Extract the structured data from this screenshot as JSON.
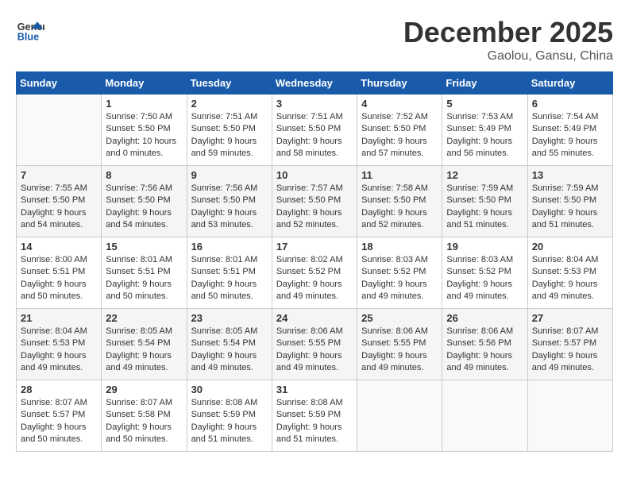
{
  "header": {
    "logo_line1": "General",
    "logo_line2": "Blue",
    "month": "December 2025",
    "location": "Gaolou, Gansu, China"
  },
  "days_of_week": [
    "Sunday",
    "Monday",
    "Tuesday",
    "Wednesday",
    "Thursday",
    "Friday",
    "Saturday"
  ],
  "weeks": [
    [
      {
        "day": "",
        "content": ""
      },
      {
        "day": "1",
        "content": "Sunrise: 7:50 AM\nSunset: 5:50 PM\nDaylight: 10 hours\nand 0 minutes."
      },
      {
        "day": "2",
        "content": "Sunrise: 7:51 AM\nSunset: 5:50 PM\nDaylight: 9 hours\nand 59 minutes."
      },
      {
        "day": "3",
        "content": "Sunrise: 7:51 AM\nSunset: 5:50 PM\nDaylight: 9 hours\nand 58 minutes."
      },
      {
        "day": "4",
        "content": "Sunrise: 7:52 AM\nSunset: 5:50 PM\nDaylight: 9 hours\nand 57 minutes."
      },
      {
        "day": "5",
        "content": "Sunrise: 7:53 AM\nSunset: 5:49 PM\nDaylight: 9 hours\nand 56 minutes."
      },
      {
        "day": "6",
        "content": "Sunrise: 7:54 AM\nSunset: 5:49 PM\nDaylight: 9 hours\nand 55 minutes."
      }
    ],
    [
      {
        "day": "7",
        "content": "Sunrise: 7:55 AM\nSunset: 5:50 PM\nDaylight: 9 hours\nand 54 minutes."
      },
      {
        "day": "8",
        "content": "Sunrise: 7:56 AM\nSunset: 5:50 PM\nDaylight: 9 hours\nand 54 minutes."
      },
      {
        "day": "9",
        "content": "Sunrise: 7:56 AM\nSunset: 5:50 PM\nDaylight: 9 hours\nand 53 minutes."
      },
      {
        "day": "10",
        "content": "Sunrise: 7:57 AM\nSunset: 5:50 PM\nDaylight: 9 hours\nand 52 minutes."
      },
      {
        "day": "11",
        "content": "Sunrise: 7:58 AM\nSunset: 5:50 PM\nDaylight: 9 hours\nand 52 minutes."
      },
      {
        "day": "12",
        "content": "Sunrise: 7:59 AM\nSunset: 5:50 PM\nDaylight: 9 hours\nand 51 minutes."
      },
      {
        "day": "13",
        "content": "Sunrise: 7:59 AM\nSunset: 5:50 PM\nDaylight: 9 hours\nand 51 minutes."
      }
    ],
    [
      {
        "day": "14",
        "content": "Sunrise: 8:00 AM\nSunset: 5:51 PM\nDaylight: 9 hours\nand 50 minutes."
      },
      {
        "day": "15",
        "content": "Sunrise: 8:01 AM\nSunset: 5:51 PM\nDaylight: 9 hours\nand 50 minutes."
      },
      {
        "day": "16",
        "content": "Sunrise: 8:01 AM\nSunset: 5:51 PM\nDaylight: 9 hours\nand 50 minutes."
      },
      {
        "day": "17",
        "content": "Sunrise: 8:02 AM\nSunset: 5:52 PM\nDaylight: 9 hours\nand 49 minutes."
      },
      {
        "day": "18",
        "content": "Sunrise: 8:03 AM\nSunset: 5:52 PM\nDaylight: 9 hours\nand 49 minutes."
      },
      {
        "day": "19",
        "content": "Sunrise: 8:03 AM\nSunset: 5:52 PM\nDaylight: 9 hours\nand 49 minutes."
      },
      {
        "day": "20",
        "content": "Sunrise: 8:04 AM\nSunset: 5:53 PM\nDaylight: 9 hours\nand 49 minutes."
      }
    ],
    [
      {
        "day": "21",
        "content": "Sunrise: 8:04 AM\nSunset: 5:53 PM\nDaylight: 9 hours\nand 49 minutes."
      },
      {
        "day": "22",
        "content": "Sunrise: 8:05 AM\nSunset: 5:54 PM\nDaylight: 9 hours\nand 49 minutes."
      },
      {
        "day": "23",
        "content": "Sunrise: 8:05 AM\nSunset: 5:54 PM\nDaylight: 9 hours\nand 49 minutes."
      },
      {
        "day": "24",
        "content": "Sunrise: 8:06 AM\nSunset: 5:55 PM\nDaylight: 9 hours\nand 49 minutes."
      },
      {
        "day": "25",
        "content": "Sunrise: 8:06 AM\nSunset: 5:55 PM\nDaylight: 9 hours\nand 49 minutes."
      },
      {
        "day": "26",
        "content": "Sunrise: 8:06 AM\nSunset: 5:56 PM\nDaylight: 9 hours\nand 49 minutes."
      },
      {
        "day": "27",
        "content": "Sunrise: 8:07 AM\nSunset: 5:57 PM\nDaylight: 9 hours\nand 49 minutes."
      }
    ],
    [
      {
        "day": "28",
        "content": "Sunrise: 8:07 AM\nSunset: 5:57 PM\nDaylight: 9 hours\nand 50 minutes."
      },
      {
        "day": "29",
        "content": "Sunrise: 8:07 AM\nSunset: 5:58 PM\nDaylight: 9 hours\nand 50 minutes."
      },
      {
        "day": "30",
        "content": "Sunrise: 8:08 AM\nSunset: 5:59 PM\nDaylight: 9 hours\nand 51 minutes."
      },
      {
        "day": "31",
        "content": "Sunrise: 8:08 AM\nSunset: 5:59 PM\nDaylight: 9 hours\nand 51 minutes."
      },
      {
        "day": "",
        "content": ""
      },
      {
        "day": "",
        "content": ""
      },
      {
        "day": "",
        "content": ""
      }
    ]
  ]
}
